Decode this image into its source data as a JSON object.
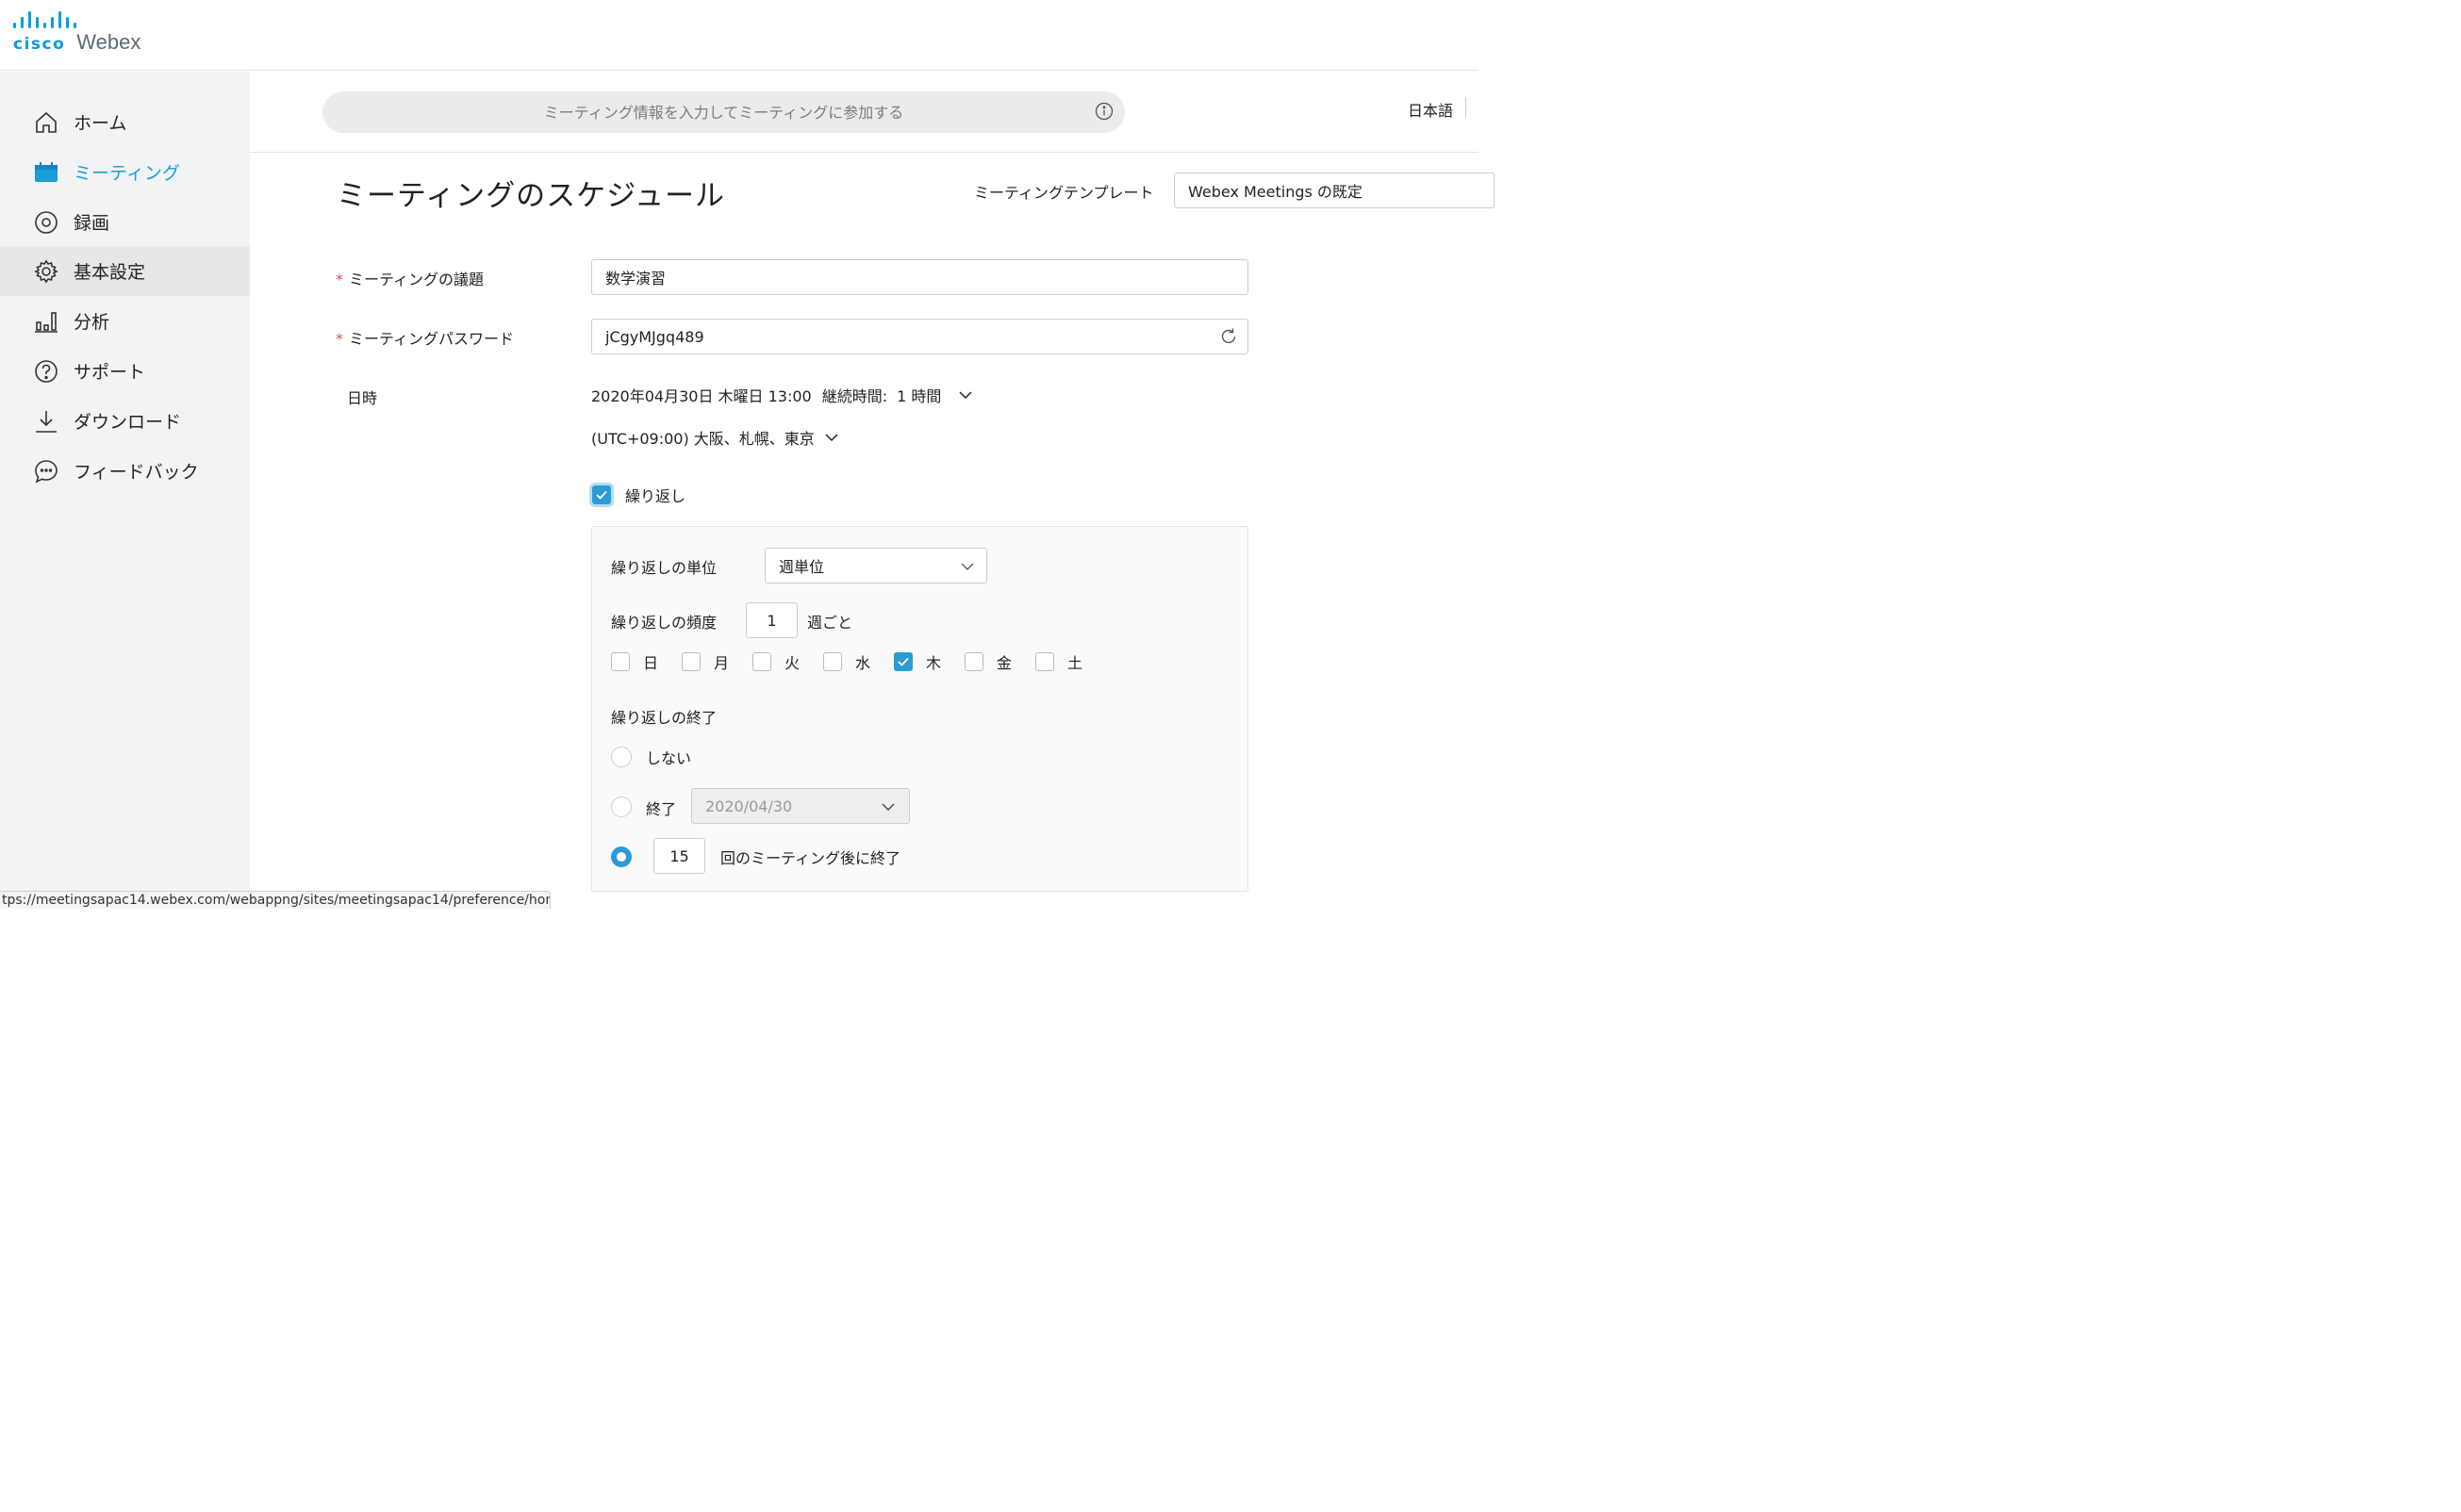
{
  "brand": {
    "cisco": "cisco",
    "webex": "Webex",
    "accent": "#049fd9"
  },
  "sidebar": {
    "items": [
      {
        "label": "ホーム",
        "icon": "home-icon"
      },
      {
        "label": "ミーティング",
        "icon": "calendar-icon",
        "active": true
      },
      {
        "label": "録画",
        "icon": "record-icon"
      },
      {
        "label": "基本設定",
        "icon": "gear-icon",
        "selected": true
      },
      {
        "label": "分析",
        "icon": "bar-chart-icon"
      },
      {
        "label": "サポート",
        "icon": "help-icon"
      },
      {
        "label": "ダウンロード",
        "icon": "download-icon"
      },
      {
        "label": "フィードバック",
        "icon": "chat-icon"
      }
    ]
  },
  "header": {
    "search_placeholder": "ミーティング情報を入力してミーティングに参加する",
    "language": "日本語"
  },
  "page": {
    "title": "ミーティングのスケジュール",
    "template_label": "ミーティングテンプレート",
    "template_value": "Webex Meetings の既定"
  },
  "form": {
    "required_mark": "*",
    "topic_label": "ミーティングの議題",
    "topic_value": "数学演習",
    "password_label": "ミーティングパスワード",
    "password_value": "jCgyMJgq489",
    "datetime_label": "日時",
    "datetime_value": "2020年04月30日 木曜日 13:00",
    "duration_label": "継続時間:",
    "duration_value": "1 時間",
    "timezone_value": "(UTC+09:00) 大阪、札幌、東京",
    "repeat_label": "繰り返し",
    "repeat_checked": true
  },
  "recurrence": {
    "unit_label": "繰り返しの単位",
    "unit_value": "週単位",
    "frequency_label": "繰り返しの頻度",
    "frequency_value": "1",
    "frequency_suffix": "週ごと",
    "days": [
      {
        "label": "日",
        "checked": false
      },
      {
        "label": "月",
        "checked": false
      },
      {
        "label": "火",
        "checked": false
      },
      {
        "label": "水",
        "checked": false
      },
      {
        "label": "木",
        "checked": true
      },
      {
        "label": "金",
        "checked": false
      },
      {
        "label": "土",
        "checked": false
      }
    ],
    "end_label": "繰り返しの終了",
    "end_never_label": "しない",
    "end_date_label": "終了",
    "end_date_value": "2020/04/30",
    "end_count_value": "15",
    "end_count_suffix": "回のミーティング後に終了",
    "selected_end": "count"
  },
  "status_url": "tps://meetingsapac14.webex.com/webappng/sites/meetingsapac14/preference/home"
}
